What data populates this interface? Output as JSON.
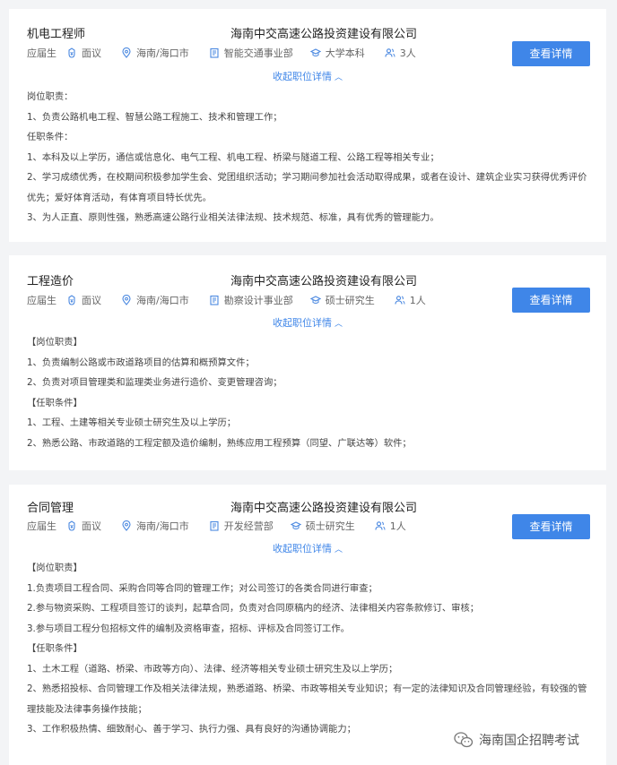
{
  "jobs": [
    {
      "title": "机电工程师",
      "company": "海南中交高速公路投资建设有限公司",
      "type": "应届生",
      "salary": "面议",
      "location": "海南/海口市",
      "department": "智能交通事业部",
      "education": "大学本科",
      "headcount": "3人",
      "button_label": "查看详情",
      "collapse_label": "收起职位详情",
      "description": [
        "岗位职责：",
        "1、负责公路机电工程、智慧公路工程施工、技术和管理工作；",
        "任职条件：",
        "1、本科及以上学历，通信或信息化、电气工程、机电工程、桥梁与隧道工程、公路工程等相关专业；",
        "2、学习成绩优秀，在校期间积极参加学生会、党团组织活动；学习期间参加社会活动取得成果，或者在设计、建筑企业实习获得优秀评价优先；爱好体育活动，有体育项目特长优先。",
        "3、为人正直、原则性强，熟悉高速公路行业相关法律法规、技术规范、标准，具有优秀的管理能力。"
      ]
    },
    {
      "title": "工程造价",
      "company": "海南中交高速公路投资建设有限公司",
      "type": "应届生",
      "salary": "面议",
      "location": "海南/海口市",
      "department": "勘察设计事业部",
      "education": "硕士研究生",
      "headcount": "1人",
      "button_label": "查看详情",
      "collapse_label": "收起职位详情",
      "description": [
        "【岗位职责】",
        "1、负责编制公路或市政道路项目的估算和概预算文件；",
        "2、负责对项目管理类和监理类业务进行造价、变更管理咨询；",
        "【任职条件】",
        "1、工程、土建等相关专业硕士研究生及以上学历；",
        "2、熟悉公路、市政道路的工程定额及造价编制，熟练应用工程预算（同望、广联达等）软件；"
      ]
    },
    {
      "title": "合同管理",
      "company": "海南中交高速公路投资建设有限公司",
      "type": "应届生",
      "salary": "面议",
      "location": "海南/海口市",
      "department": "开发经营部",
      "education": "硕士研究生",
      "headcount": "1人",
      "button_label": "查看详情",
      "collapse_label": "收起职位详情",
      "description": [
        "【岗位职责】",
        "1.负责项目工程合同、采购合同等合同的管理工作；对公司签订的各类合同进行审查；",
        "2.参与物资采购、工程项目签订的谈判，起草合同，负责对合同原稿内的经济、法律相关内容条款修订、审核；",
        "3.参与项目工程分包招标文件的编制及资格审查，招标、评标及合同签订工作。",
        "【任职条件】",
        "1、土木工程（道路、桥梁、市政等方向）、法律、经济等相关专业硕士研究生及以上学历；",
        "2、熟悉招投标、合同管理工作及相关法律法规，熟悉道路、桥梁、市政等相关专业知识；有一定的法律知识及合同管理经验，有较强的管理技能及法律事务操作技能；",
        "3、工作积极热情、细致耐心、善于学习、执行力强、具有良好的沟通协调能力；"
      ]
    }
  ],
  "watermark": {
    "text": "海南国企招聘考试",
    "icon": "wechat-icon"
  },
  "icons": {
    "salary": "coin-icon",
    "location": "location-pin-icon",
    "department": "building-icon",
    "education": "graduation-cap-icon",
    "headcount": "people-icon",
    "collapse": "chevron-up-icon"
  },
  "colors": {
    "accent": "#3f86e8",
    "background": "#f3f4f6"
  }
}
